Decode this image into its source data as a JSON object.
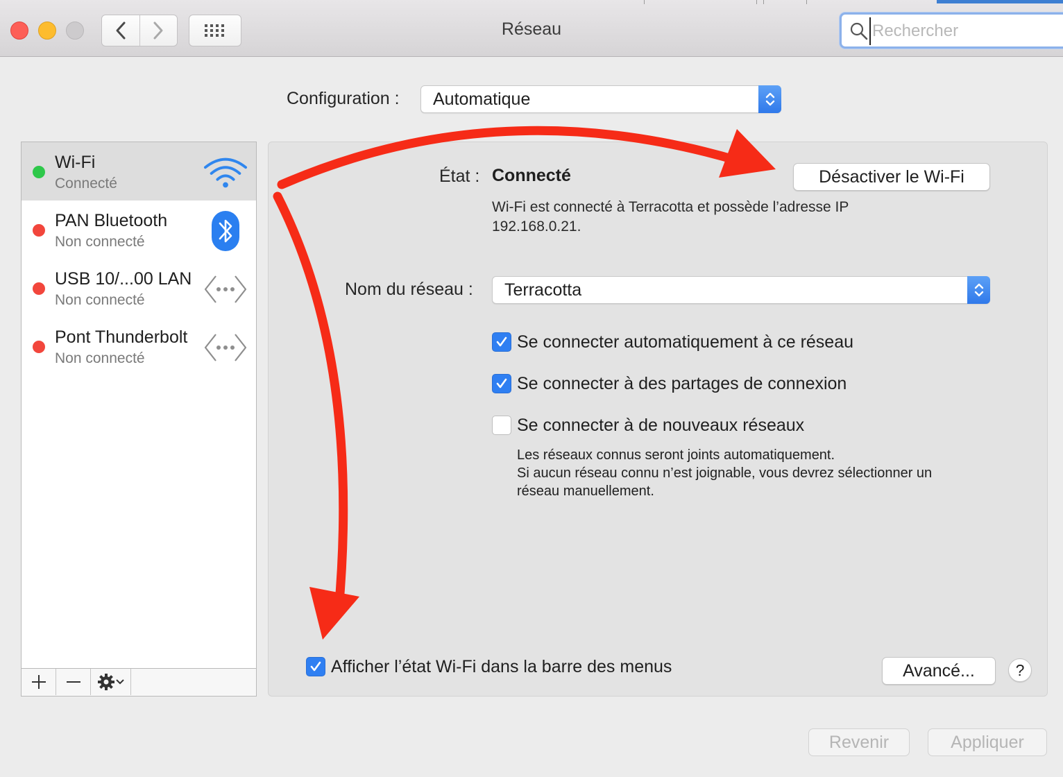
{
  "window": {
    "title": "Réseau",
    "search_placeholder": "Rechercher"
  },
  "toolbar": {
    "back_icon": "chevron-left-icon",
    "forward_icon": "chevron-right-icon",
    "grid_icon": "grid-icon"
  },
  "config": {
    "label": "Configuration :",
    "value": "Automatique"
  },
  "sidebar": {
    "items": [
      {
        "name": "Wi-Fi",
        "status": "Connecté",
        "status_color": "#2ec84a",
        "icon": "wifi-icon",
        "selected": true
      },
      {
        "name": "PAN Bluetooth",
        "status": "Non connecté",
        "status_color": "#f2463c",
        "icon": "bluetooth-icon"
      },
      {
        "name": "USB 10/...00 LAN",
        "status": "Non connecté",
        "status_color": "#f2463c",
        "icon": "ethernet-icon"
      },
      {
        "name": "Pont Thunderbolt",
        "status": "Non connecté",
        "status_color": "#f2463c",
        "icon": "ethernet-icon"
      }
    ],
    "add_label": "+",
    "remove_label": "—"
  },
  "panel": {
    "state_label": "État :",
    "state_value": "Connecté",
    "disable_button": "Désactiver le Wi-Fi",
    "state_desc_line1": "Wi-Fi est connecté à Terracotta et possède l’adresse IP",
    "state_desc_line2": "192.168.0.21.",
    "network_label": "Nom du réseau :",
    "network_value": "Terracotta",
    "options": [
      {
        "label": "Se connecter automatiquement à ce réseau",
        "checked": true
      },
      {
        "label": "Se connecter à des partages de connexion",
        "checked": true
      },
      {
        "label": "Se connecter à de nouveaux réseaux",
        "checked": false
      }
    ],
    "note_line1": "Les réseaux connus seront joints automatiquement.",
    "note_line2": "Si aucun réseau connu n’est joignable, vous devrez sélectionner un",
    "note_line3": "réseau manuellement.",
    "show_wifi_label": "Afficher l’état Wi-Fi dans la barre des menus",
    "show_wifi_checked": true,
    "advanced_button": "Avancé...",
    "help_button": "?"
  },
  "footer": {
    "revert_button": "Revenir",
    "apply_button": "Appliquer"
  },
  "colors": {
    "accent": "#2f7ff2",
    "annotation_arrow": "#f62b17"
  }
}
